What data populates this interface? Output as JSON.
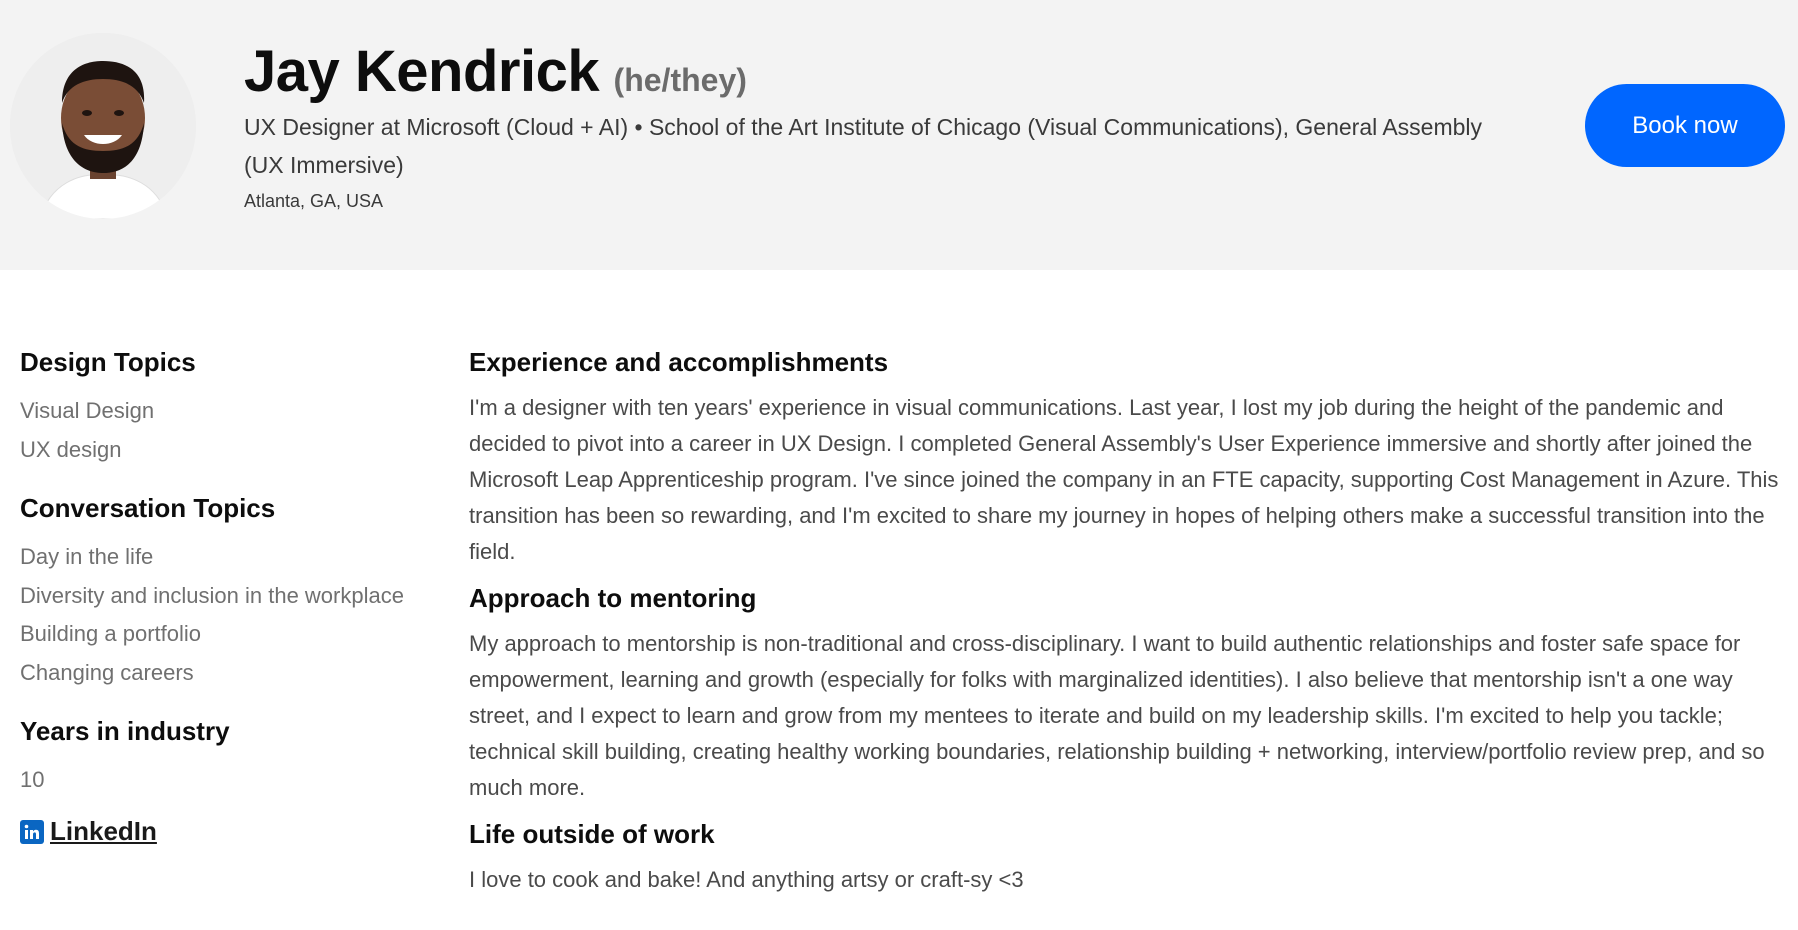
{
  "profile": {
    "name": "Jay Kendrick",
    "pronouns": "(he/they)",
    "headline": "UX Designer at Microsoft (Cloud + AI) • School of the Art Institute of Chicago (Visual Communications), General Assembly (UX Immersive)",
    "location": "Atlanta, GA, USA",
    "avatar_icon": "profile-photo"
  },
  "actions": {
    "book_label": "Book now",
    "accent_color": "#0066ff"
  },
  "sidebar": {
    "design_topics": {
      "heading": "Design Topics",
      "items": [
        "Visual Design",
        "UX design"
      ]
    },
    "conversation_topics": {
      "heading": "Conversation Topics",
      "items": [
        "Day in the life",
        "Diversity and inclusion in the workplace",
        "Building a portfolio",
        "Changing careers"
      ]
    },
    "years": {
      "heading": "Years in industry",
      "value": "10"
    },
    "linkedin": {
      "label": "LinkedIn",
      "icon": "linkedin-icon",
      "icon_color": "#0a66c2"
    }
  },
  "main": {
    "sections": [
      {
        "heading": "Experience and accomplishments",
        "body": "I'm a designer with ten years' experience in visual communications. Last year, I lost my job during the height of the pandemic and decided to pivot into a career in UX Design. I completed General Assembly's User Experience immersive and shortly after joined the Microsoft Leap Apprenticeship program. I've since joined the company in an FTE capacity, supporting Cost Management in Azure. This transition has been so rewarding, and I'm excited to share my journey in hopes of helping others make a successful transition into the field."
      },
      {
        "heading": "Approach to mentoring",
        "body": "My approach to mentorship is non-traditional and cross-disciplinary. I want to build authentic relationships and foster safe space for empowerment, learning and growth (especially for folks with marginalized identities). I also believe that mentorship isn't a one way street, and I expect to learn and grow from my mentees to iterate and build on my leadership skills. I'm excited to help you tackle; technical skill building, creating healthy working boundaries, relationship building + networking, interview/portfolio review prep, and so much more."
      },
      {
        "heading": "Life outside of work",
        "body": "I love to cook and bake! And anything artsy or craft-sy <3"
      }
    ]
  }
}
